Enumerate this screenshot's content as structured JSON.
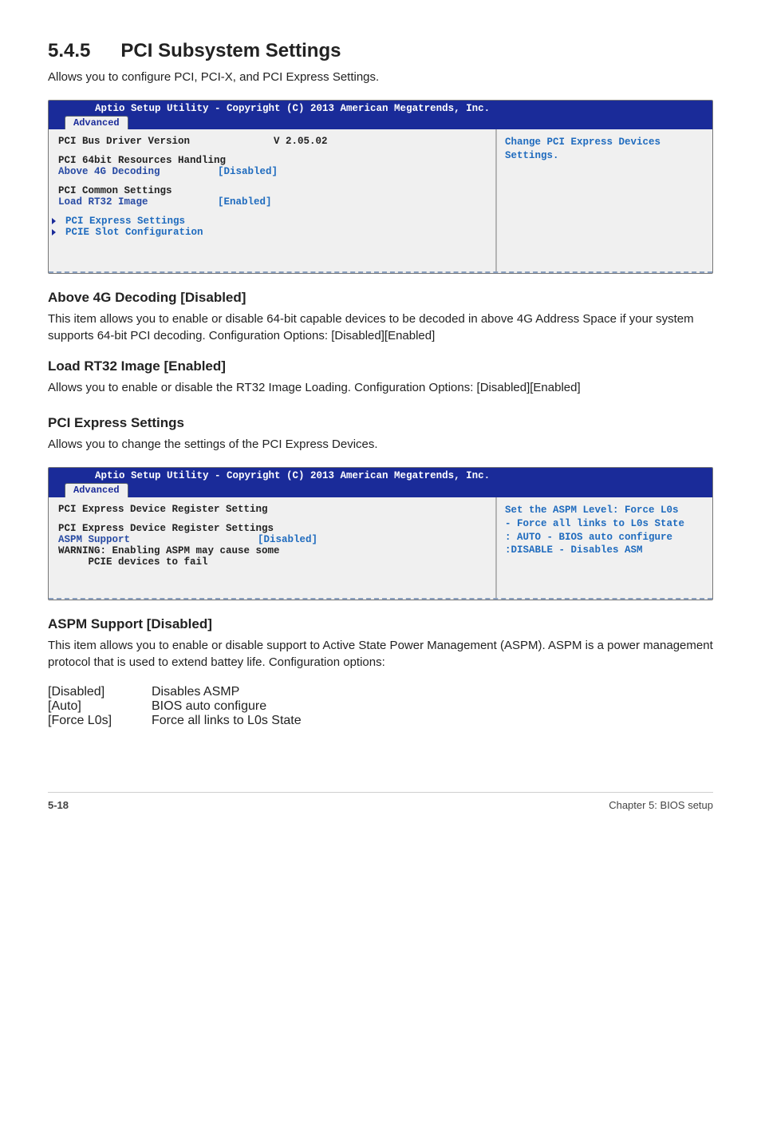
{
  "section": {
    "number": "5.4.5",
    "title": "PCI Subsystem Settings"
  },
  "intro1": "Allows you to configure PCI, PCI-X, and PCI Express Settings.",
  "bios1": {
    "utility_title": "Aptio Setup Utility - Copyright (C) 2013 American Megatrends, Inc.",
    "tab_active": "Advanced",
    "row_driver_label": "PCI Bus Driver Version",
    "row_driver_value": "V 2.05.02",
    "group1_header": "PCI 64bit Resources Handling",
    "row_4g_label": "Above 4G Decoding",
    "row_4g_value": "[Disabled]",
    "group2_header": "PCI Common Settings",
    "row_rt32_label": "Load RT32 Image",
    "row_rt32_value": "[Enabled]",
    "sub1": "PCI Express Settings",
    "sub2": "PCIE Slot Configuration",
    "help": "Change PCI Express Devices Settings."
  },
  "above4g": {
    "heading": "Above 4G Decoding [Disabled]",
    "body": "This item allows you to enable or disable 64-bit capable devices to be decoded in above 4G Address Space if your system supports 64-bit PCI decoding. Configuration Options: [Disabled][Enabled]"
  },
  "rt32": {
    "heading": "Load RT32 Image [Enabled]",
    "body": "Allows you to enable or disable the RT32 Image Loading. Configuration Options: [Disabled][Enabled]"
  },
  "pci_express_heading": "PCI Express Settings",
  "pci_express_desc": "Allows you to change the settings of the PCI Express Devices.",
  "bios2": {
    "utility_title": "Aptio Setup Utility - Copyright (C) 2013 American Megatrends, Inc.",
    "tab_active": "Advanced",
    "line1": "PCI Express Device Register Setting",
    "line2": "PCI Express Device Register Settings",
    "aspm_label": "ASPM Support",
    "aspm_value": "[Disabled]",
    "warn1": "WARNING: Enabling ASPM may cause some",
    "warn2": "     PCIE devices to fail",
    "help": "Set the ASPM Level: Force L0s\n- Force all links to L0s State\n: AUTO - BIOS auto configure :DISABLE - Disables ASM"
  },
  "aspm": {
    "heading": "ASPM Support [Disabled]",
    "body": "This item allows you to enable or disable support to Active State Power Management (ASPM). ASPM is a power management protocol that is used to extend battey life. Configuration options:",
    "opts": {
      "o1_label": "[Disabled]",
      "o1_desc": "Disables ASMP",
      "o2_label": "[Auto]",
      "o2_desc": "BIOS auto configure",
      "o3_label": "[Force L0s]",
      "o3_desc": "Force all links to L0s State"
    }
  },
  "footer": {
    "page": "5-18",
    "chapter": "Chapter 5: BIOS setup"
  }
}
